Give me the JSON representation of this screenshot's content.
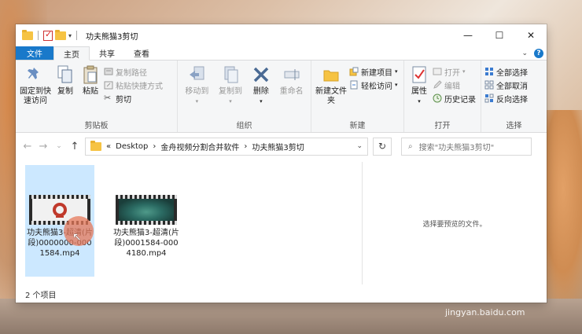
{
  "window": {
    "title": "功夫熊猫3剪切"
  },
  "titlebar": {
    "minimize": "—",
    "maximize": "☐",
    "close": "✕"
  },
  "tabs": [
    "文件",
    "主页",
    "共享",
    "查看"
  ],
  "ribbon": {
    "clipboard": {
      "label": "剪贴板",
      "pin": "固定到快速访问",
      "copy": "复制",
      "paste": "粘贴",
      "copy_path": "复制路径",
      "paste_shortcut": "粘贴快捷方式",
      "cut": "剪切"
    },
    "organize": {
      "label": "组织",
      "move_to": "移动到",
      "copy_to": "复制到",
      "delete": "删除",
      "rename": "重命名"
    },
    "new": {
      "label": "新建",
      "new_folder": "新建文件夹",
      "new_item": "新建项目",
      "easy_access": "轻松访问"
    },
    "open": {
      "label": "打开",
      "properties": "属性",
      "open": "打开",
      "edit": "编辑",
      "history": "历史记录"
    },
    "select": {
      "label": "选择",
      "select_all": "全部选择",
      "select_none": "全部取消",
      "invert": "反向选择"
    }
  },
  "address": {
    "prefix": "«",
    "parts": [
      "Desktop",
      "金舟视频分割合并软件",
      "功夫熊猫3剪切"
    ],
    "search_placeholder": "搜索\"功夫熊猫3剪切\""
  },
  "files": [
    {
      "name": "功夫熊猫3-超清(片段)0000000-0001584.mp4",
      "selected": true
    },
    {
      "name": "功夫熊猫3-超清(片段)0001584-0004180.mp4",
      "selected": false
    }
  ],
  "preview": {
    "message": "选择要预览的文件。"
  },
  "status": {
    "count": "2 个项目"
  },
  "watermark": {
    "text": "Baidu经验",
    "url": "jingyan.baidu.com"
  }
}
